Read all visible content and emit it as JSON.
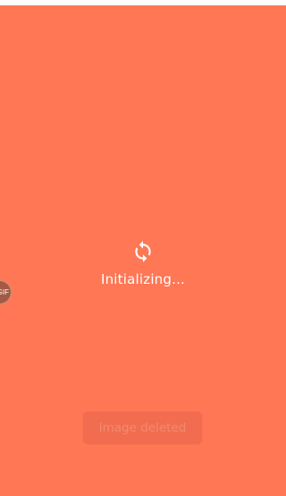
{
  "loader": {
    "icon": "sync-icon",
    "status_text": "Initializing..."
  },
  "gif_badge": {
    "label": "GIF"
  },
  "toast": {
    "message": "Image deleted"
  },
  "colors": {
    "background": "#ff7755",
    "badge": "#a35a45",
    "toast": "#f26d4f"
  }
}
